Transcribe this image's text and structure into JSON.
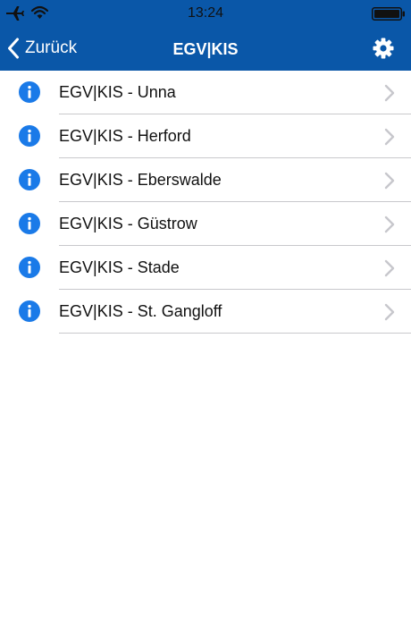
{
  "status_bar": {
    "time": "13:24",
    "icons": [
      "airplane-icon",
      "wifi-icon",
      "battery-icon"
    ]
  },
  "nav_bar": {
    "back_label": "Zurück",
    "title": "EGV|KIS",
    "right_icon": "gear-icon"
  },
  "list": {
    "items": [
      {
        "label": "EGV|KIS - Unna"
      },
      {
        "label": "EGV|KIS - Herford"
      },
      {
        "label": "EGV|KIS - Eberswalde"
      },
      {
        "label": "EGV|KIS - Güstrow"
      },
      {
        "label": "EGV|KIS - Stade"
      },
      {
        "label": "EGV|KIS - St. Gangloff"
      }
    ]
  },
  "colors": {
    "nav_background": "#0a57a8",
    "info_icon": "#1a7ae8",
    "chevron": "#c7c7cc",
    "divider": "#c8c8cc"
  }
}
